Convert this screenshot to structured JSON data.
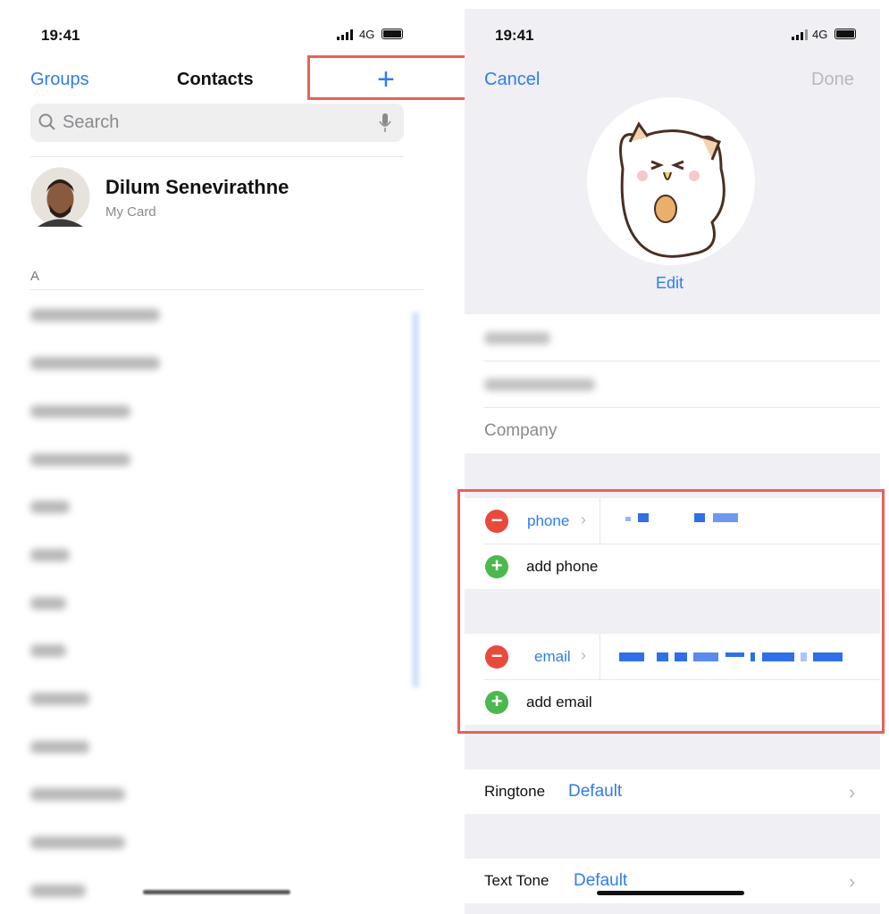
{
  "left": {
    "status": {
      "time": "19:41",
      "network": "4G"
    },
    "nav": {
      "groups": "Groups",
      "title": "Contacts",
      "add_icon": "plus-icon"
    },
    "search": {
      "placeholder": "Search",
      "icon": "search-icon",
      "mic_icon": "microphone-icon"
    },
    "my_card": {
      "name": "Dilum Senevirathne",
      "subtitle": "My Card"
    },
    "section": "A"
  },
  "right": {
    "status": {
      "time": "19:41",
      "network": "4G"
    },
    "nav": {
      "cancel": "Cancel",
      "done": "Done"
    },
    "photo": {
      "edit": "Edit"
    },
    "fields": {
      "company_placeholder": "Company"
    },
    "phone": {
      "label": "phone",
      "add": "add phone"
    },
    "email": {
      "label": "email",
      "add": "add email"
    },
    "ringtone": {
      "label": "Ringtone",
      "value": "Default"
    },
    "text_tone": {
      "label": "Text Tone",
      "value": "Default"
    }
  },
  "colors": {
    "accent": "#2f7cf0",
    "highlight": "#e8615a",
    "remove": "#e84a3c",
    "add": "#4cb84f"
  }
}
